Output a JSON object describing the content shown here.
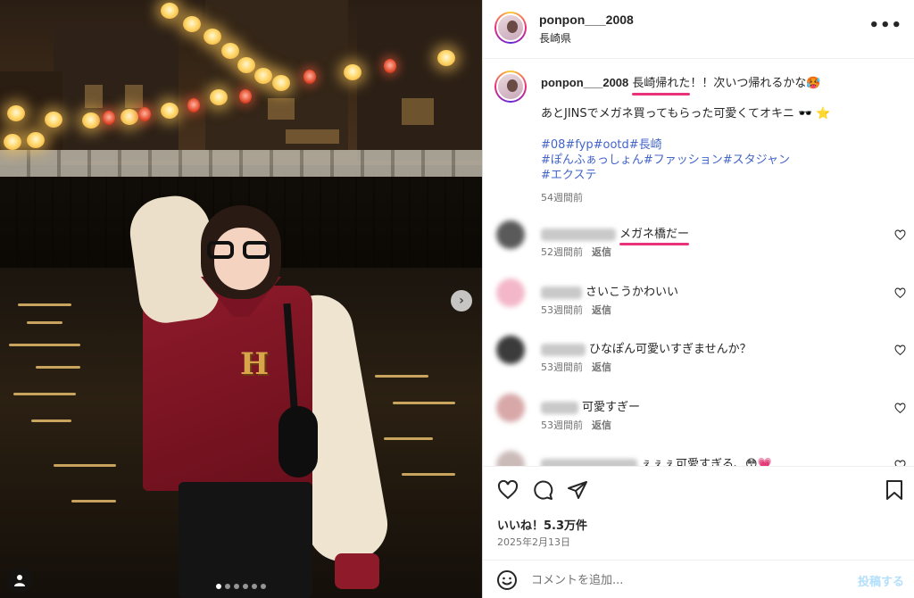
{
  "post": {
    "username": "ponpon___2008",
    "location": "長崎県",
    "more_label": "•••",
    "carousel_next": "›",
    "carousel_total": 6,
    "carousel_active": 0
  },
  "caption": {
    "username": "ponpon___2008",
    "text_highlight": "長崎帰れた",
    "text_rest": "！！次いつ帰れるかな🥵",
    "line2": "あとJINSでメガネ買ってもらった可愛くてオキニ 🕶️ ⭐",
    "hashtags_line1": "#08#fyp#ootd#長崎",
    "hashtags_line2": "#ぽんふぁっしょん#ファッション#スタジャン",
    "hashtags_line3": "#エクステ",
    "time": "54週間前"
  },
  "comments": [
    {
      "text": "",
      "highlight": "メガネ橋だー",
      "time": "52週間前",
      "reply": "返信",
      "avatar_color": "#5a5a5a"
    },
    {
      "text": "さいこうかわいい",
      "highlight": "",
      "time": "53週間前",
      "reply": "返信",
      "avatar_color": "#f3b7c9"
    },
    {
      "text": "ひなぽん可愛いすぎませんか？",
      "highlight": "",
      "time": "53週間前",
      "reply": "返信",
      "avatar_color": "#3b3b3b"
    },
    {
      "text": "可愛すぎー",
      "highlight": "",
      "time": "53週間前",
      "reply": "返信",
      "avatar_color": "#d8a8a8"
    },
    {
      "text": "ぇぇぇ可愛すぎる、😳💗",
      "highlight": "",
      "time": "",
      "reply": "",
      "avatar_color": "#cbbbb8"
    }
  ],
  "engagement": {
    "likes": "いいね！5.3万件",
    "date": "2025年2月13日"
  },
  "comment_bar": {
    "placeholder": "コメントを追加...",
    "post_label": "投稿する"
  },
  "colors": {
    "highlight_underline": "#e8337b",
    "hashtag": "#4364c9",
    "secondary_text": "#737373",
    "post_button_disabled": "#b2dffc"
  },
  "icons": {
    "more": "more-icon",
    "heart": "heart-icon",
    "comment": "comment-icon",
    "share": "share-icon",
    "bookmark": "bookmark-icon",
    "emoji": "emoji-icon",
    "tag": "user-tag-icon",
    "next": "chevron-right-icon"
  }
}
